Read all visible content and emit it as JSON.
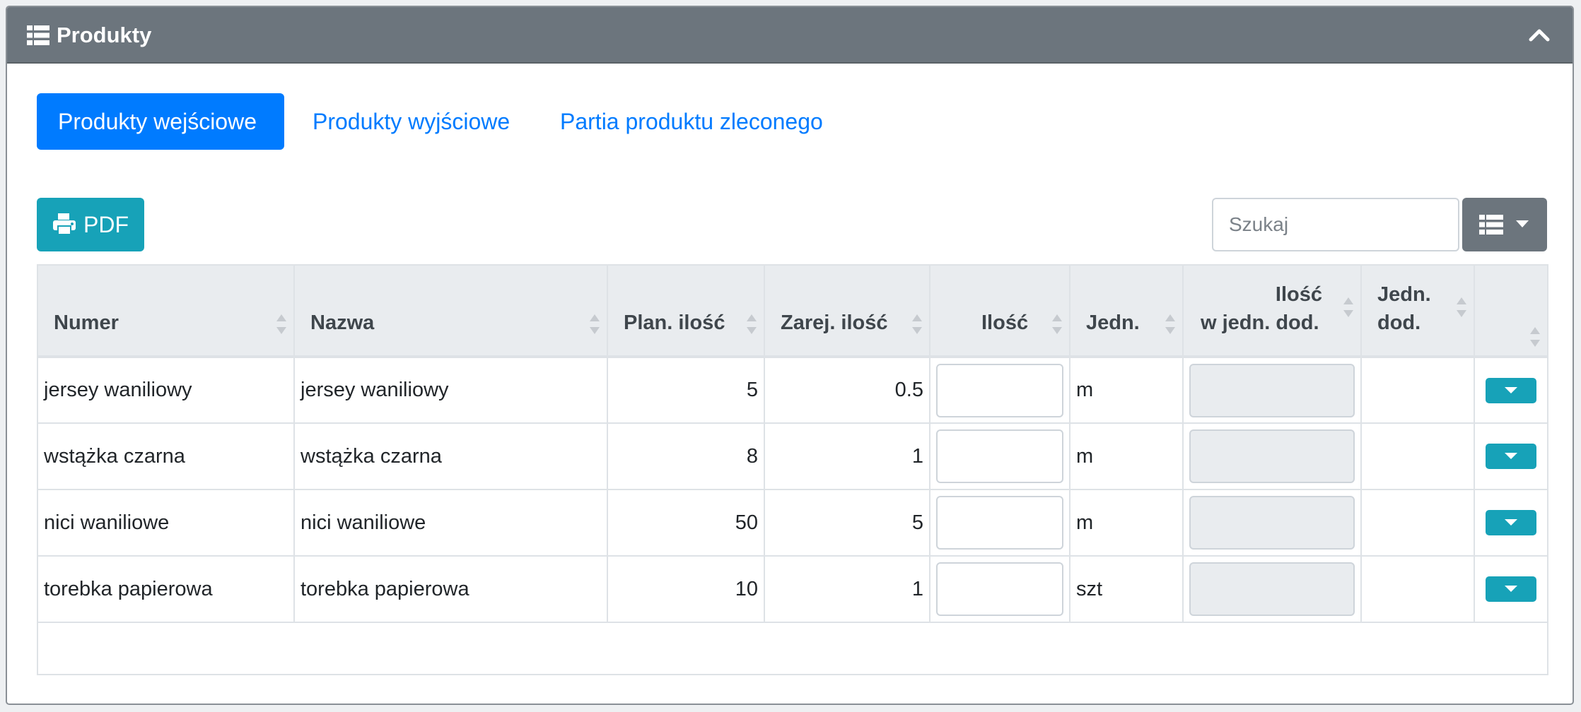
{
  "header": {
    "title": "Produkty",
    "icon": "list-icon",
    "collapse_icon": "chevron-up-icon"
  },
  "tabs": [
    {
      "label": "Produkty wejściowe",
      "active": true
    },
    {
      "label": "Produkty wyjściowe",
      "active": false
    },
    {
      "label": "Partia produktu zleconego",
      "active": false
    }
  ],
  "toolbar": {
    "pdf_label": "PDF",
    "pdf_icon": "printer-icon",
    "search_placeholder": "Szukaj",
    "columns_icon": "list-icon"
  },
  "table": {
    "columns": {
      "numer": "Numer",
      "nazwa": "Nazwa",
      "plan": "Plan. ilość",
      "zarej": "Zarej. ilość",
      "ilosc": "Ilość",
      "jedn": "Jedn.",
      "ilosc_dod_line1": "Ilość",
      "ilosc_dod_line2": "w jedn. dod.",
      "jedn_dod_line1": "Jedn.",
      "jedn_dod_line2": "dod."
    },
    "rows": [
      {
        "numer": "jersey waniliowy",
        "nazwa": "jersey waniliowy",
        "plan": "5",
        "zarej": "0.5",
        "jedn": "m"
      },
      {
        "numer": "wstążka czarna",
        "nazwa": "wstążka czarna",
        "plan": "8",
        "zarej": "1",
        "jedn": "m"
      },
      {
        "numer": "nici waniliowe",
        "nazwa": "nici waniliowe",
        "plan": "50",
        "zarej": "5",
        "jedn": "m"
      },
      {
        "numer": "torebka papierowa",
        "nazwa": "torebka papierowa",
        "plan": "10",
        "zarej": "1",
        "jedn": "szt"
      }
    ]
  },
  "colors": {
    "header_bg": "#6c757d",
    "primary": "#007bff",
    "info": "#17a2b8"
  }
}
